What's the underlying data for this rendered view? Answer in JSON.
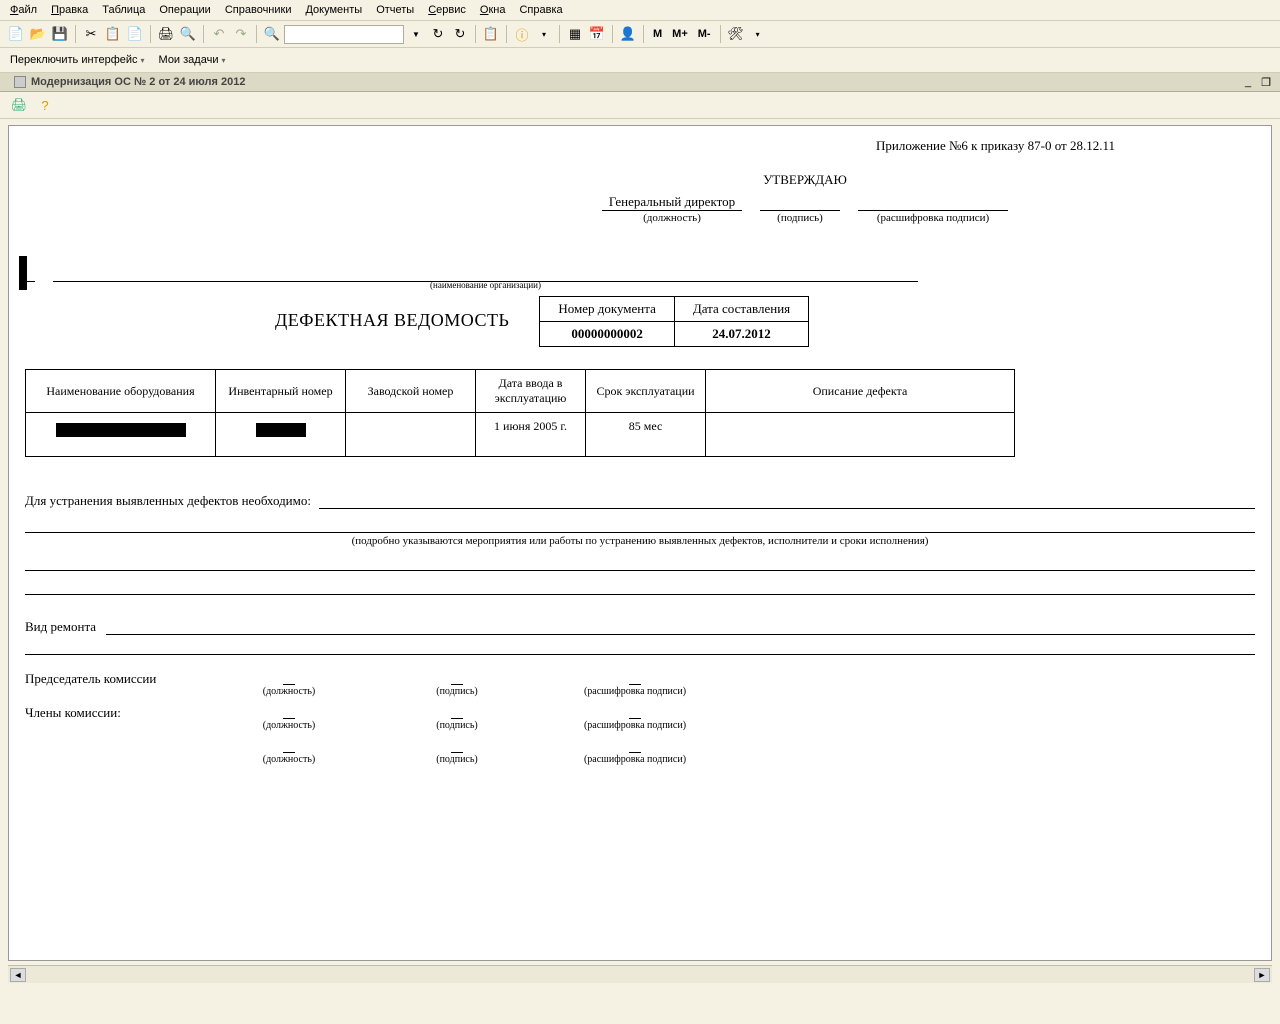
{
  "menu": {
    "file": "Файл",
    "edit": "Правка",
    "table": "Таблица",
    "ops": "Операции",
    "refs": "Справочники",
    "docs": "Документы",
    "reports": "Отчеты",
    "service": "Сервис",
    "windows": "Окна",
    "help": "Справка"
  },
  "subbar": {
    "switch": "Переключить интерфейс",
    "tasks": "Мои задачи"
  },
  "tab": {
    "title": "Модернизация ОС № 2 от 24 июля 2012"
  },
  "doc": {
    "appendix": "Приложение №6 к приказу 87-0 от 28.12.11",
    "approve": "УТВЕРЖДАЮ",
    "gendir": "Генеральный директор",
    "position": "(должность)",
    "signature": "(подпись)",
    "sig_decoded": "(расшифровка подписи)",
    "org_caption": "(наименование организации)",
    "title": "ДЕФЕКТНАЯ ВЕДОМОСТЬ",
    "num_header": "Номер документа",
    "date_header": "Дата составления",
    "num_value": "00000000002",
    "date_value": "24.07.2012",
    "th1": "Наименование оборудования",
    "th2": "Инвентарный номер",
    "th3": "Заводской номер",
    "th4": "Дата ввода в эксплуатацию",
    "th5": "Срок эксплуатации",
    "th6": "Описание дефекта",
    "td4": "1 июня 2005 г.",
    "td5": "85 мес",
    "fix_label": "Для устранения выявленных дефектов необходимо:",
    "fix_caption": "(подробно указываются мероприятия или работы по устранению выявленных дефектов, исполнители и сроки исполнения)",
    "repair": "Вид ремонта",
    "chairman": "Председатель комиссии",
    "members": "Члены комиссии:",
    "c_pos": "(должность)",
    "c_sig": "(подпись)",
    "c_dec": "(расшифровка подписи)"
  },
  "toolbar_text": {
    "m": "M",
    "mplus": "M+",
    "mminus": "M-"
  }
}
